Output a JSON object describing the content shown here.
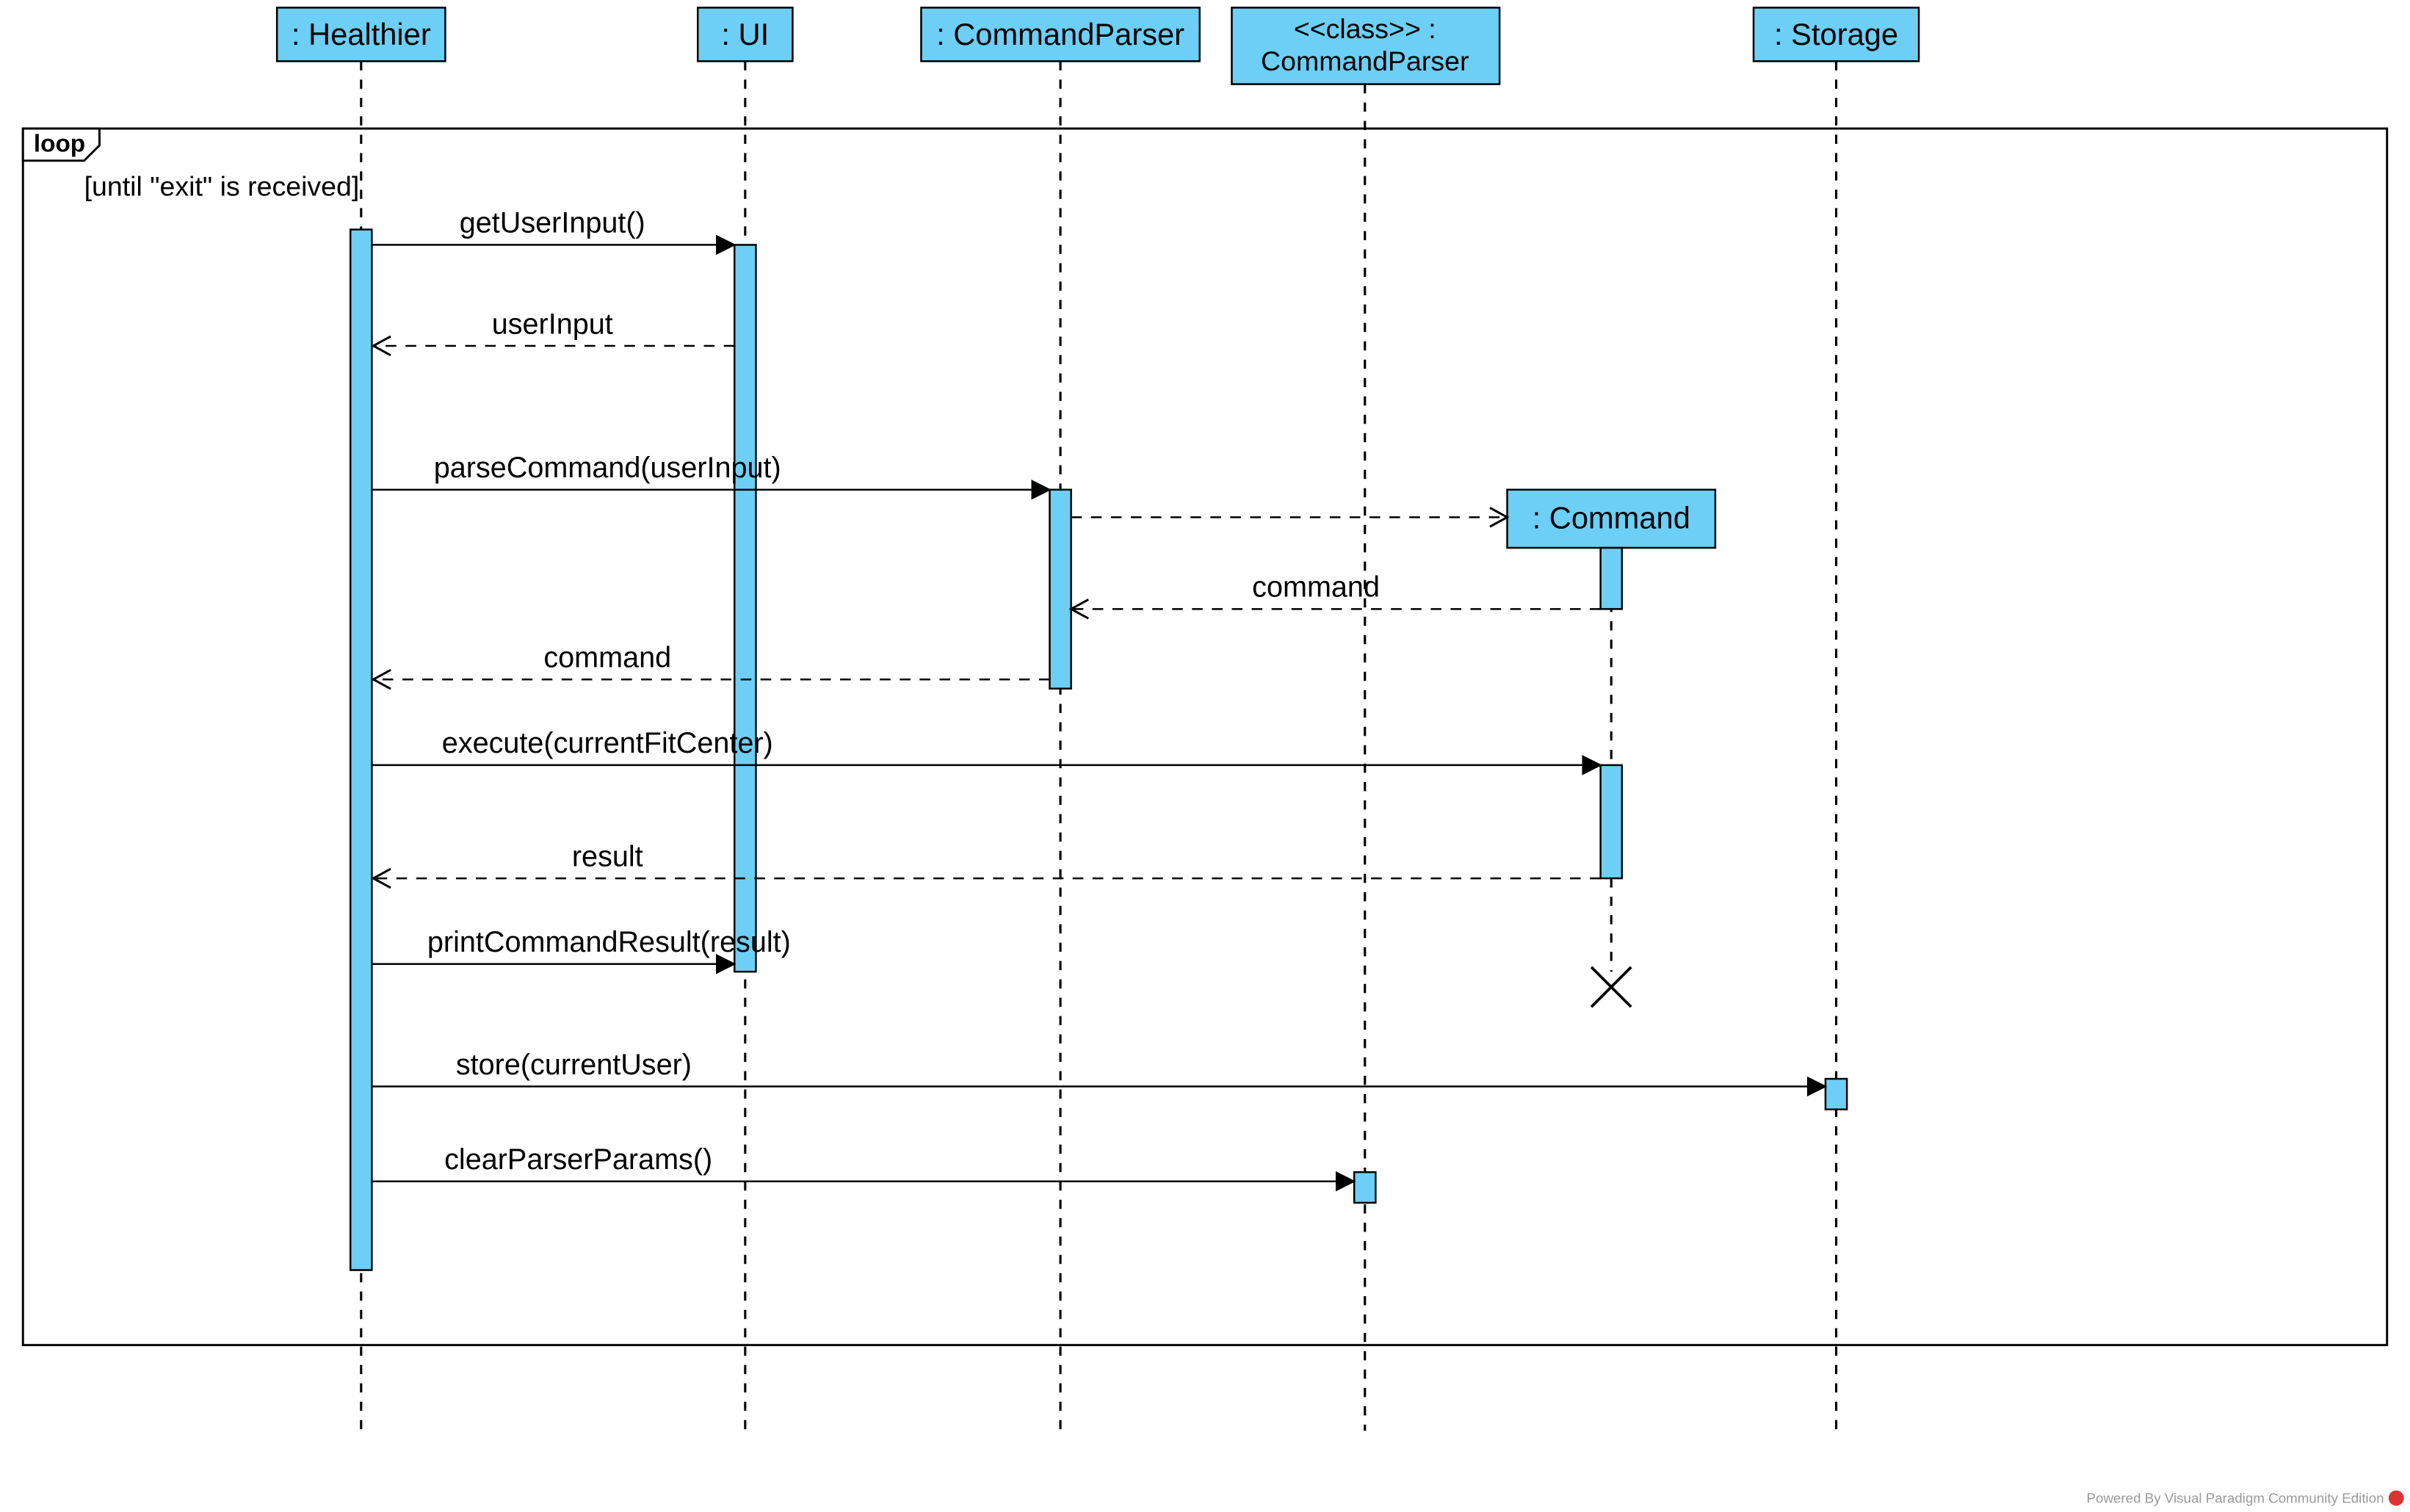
{
  "fragment": {
    "operator": "loop",
    "guard": "[until \"exit\" is received]"
  },
  "lifelines": {
    "healthier": {
      "label": ": Healthier"
    },
    "ui": {
      "label": ": UI"
    },
    "commandParser": {
      "label": ": CommandParser"
    },
    "commandParserClass": {
      "stereotype": "<<class>> :",
      "name": "CommandParser"
    },
    "storage": {
      "label": ": Storage"
    },
    "command": {
      "label": ": Command"
    }
  },
  "messages": {
    "getUserInput": "getUserInput()",
    "userInput": "userInput",
    "parseCommand": "parseCommand(userInput)",
    "commandReturn1": "command",
    "commandReturn2": "command",
    "execute": "execute(currentFitCenter)",
    "result": "result",
    "printCommandResult": "printCommandResult(result)",
    "store": "store(currentUser)",
    "clearParserParams": "clearParserParams()"
  },
  "watermark": "Powered By Visual Paradigm Community Edition"
}
